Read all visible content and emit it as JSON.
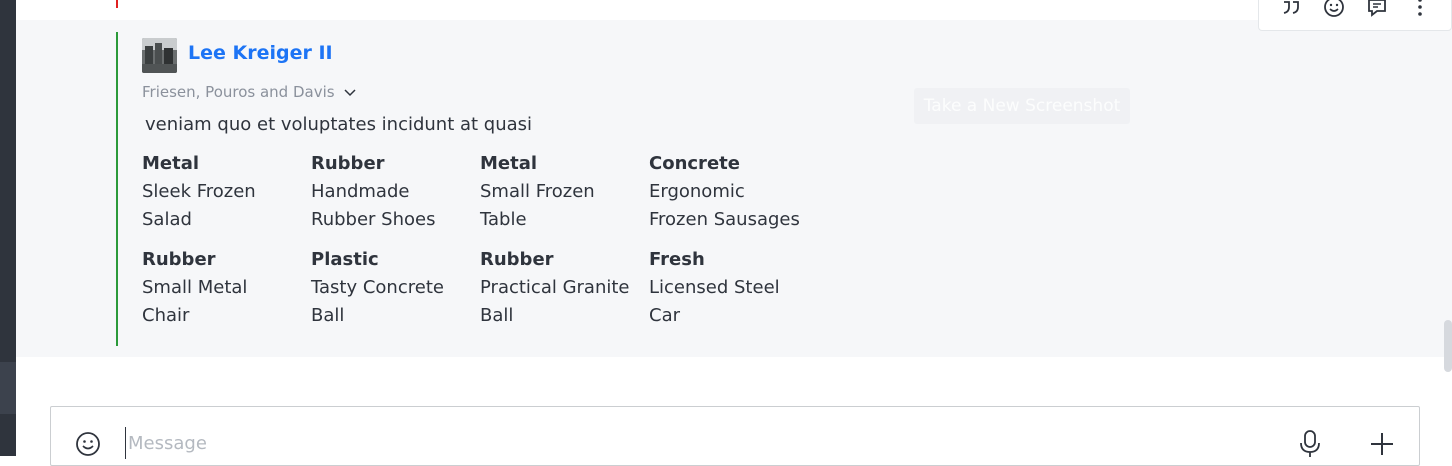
{
  "message": {
    "author": "Lee Kreiger II",
    "organization": "Friesen, Pouros and Davis",
    "text": "veniam quo et voluptates incidunt at quasi",
    "fields": [
      {
        "title": "Metal",
        "value": [
          "Sleek Frozen",
          "Salad"
        ]
      },
      {
        "title": "Rubber",
        "value": [
          "Handmade",
          "Rubber Shoes"
        ]
      },
      {
        "title": "Metal",
        "value": [
          "Small Frozen",
          "Table"
        ]
      },
      {
        "title": "Concrete",
        "value": [
          "Ergonomic",
          "Frozen Sausages"
        ]
      },
      {
        "title": "Rubber",
        "value": [
          "Small Metal",
          "Chair"
        ]
      },
      {
        "title": "Plastic",
        "value": [
          "Tasty Concrete",
          "Ball"
        ]
      },
      {
        "title": "Rubber",
        "value": [
          "Practical Granite",
          "Ball"
        ]
      },
      {
        "title": "Fresh",
        "value": [
          "Licensed Steel",
          "Car"
        ]
      }
    ]
  },
  "overlay": {
    "ghost_button": "Take a New Screenshot"
  },
  "toolbar": {
    "icons": [
      "quote-icon",
      "emoji-icon",
      "reply-thread-icon",
      "kebab-menu-icon"
    ]
  },
  "composer": {
    "placeholder": "Message"
  },
  "colors": {
    "author_link": "#1d74f5",
    "thread_line": "#2b9a3a",
    "message_bg": "#f6f7f9",
    "text": "#2f343d",
    "muted": "#8b919c"
  }
}
